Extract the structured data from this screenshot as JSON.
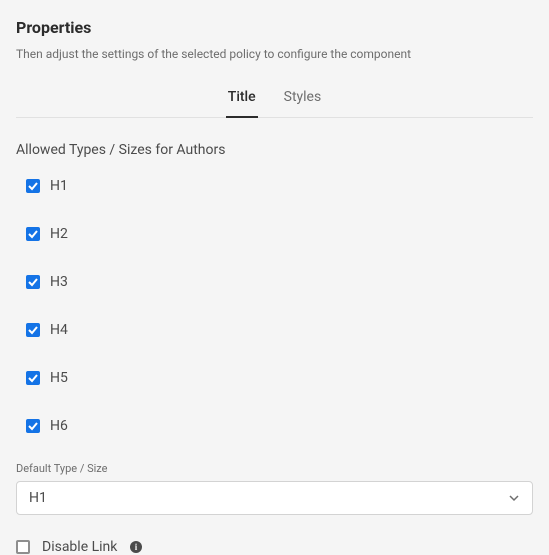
{
  "header": {
    "title": "Properties",
    "subtitle": "Then adjust the settings of the selected policy to configure the component"
  },
  "tabs": {
    "title": "Title",
    "styles": "Styles"
  },
  "section": {
    "allowed_label": "Allowed Types / Sizes for Authors",
    "items": {
      "h1": "H1",
      "h2": "H2",
      "h3": "H3",
      "h4": "H4",
      "h5": "H5",
      "h6": "H6"
    }
  },
  "default_type": {
    "label": "Default Type / Size",
    "value": "H1"
  },
  "disable_link": {
    "label": "Disable Link"
  }
}
